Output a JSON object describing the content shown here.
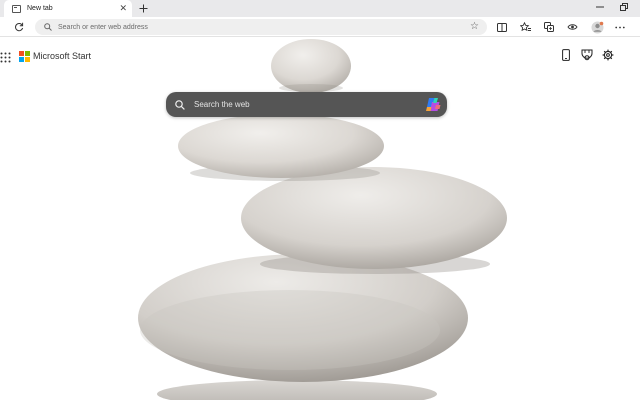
{
  "browser": {
    "tab": {
      "title": "New tab",
      "close_icon": "close-icon"
    },
    "new_tab_icon": "plus-icon",
    "window_controls": [
      "minimize-icon",
      "restore-icon"
    ],
    "address_bar": {
      "placeholder": "Search or enter web address"
    },
    "toolbar_icons": [
      "refresh-icon",
      "search-icon",
      "favorite-star-icon",
      "split-screen-icon",
      "favorites-icon",
      "collections-icon",
      "extensions-icon",
      "profile-avatar"
    ]
  },
  "page": {
    "brand": {
      "title": "Microsoft Start",
      "logo_colors": [
        "#f25022",
        "#7fba00",
        "#00a4ef",
        "#ffb900"
      ]
    },
    "header_icons": [
      "phone-icon",
      "rewards-icon",
      "settings-gear-icon"
    ],
    "search": {
      "placeholder": "Search the web",
      "accent": "#555555"
    },
    "background_image": "balanced-stones-image"
  }
}
